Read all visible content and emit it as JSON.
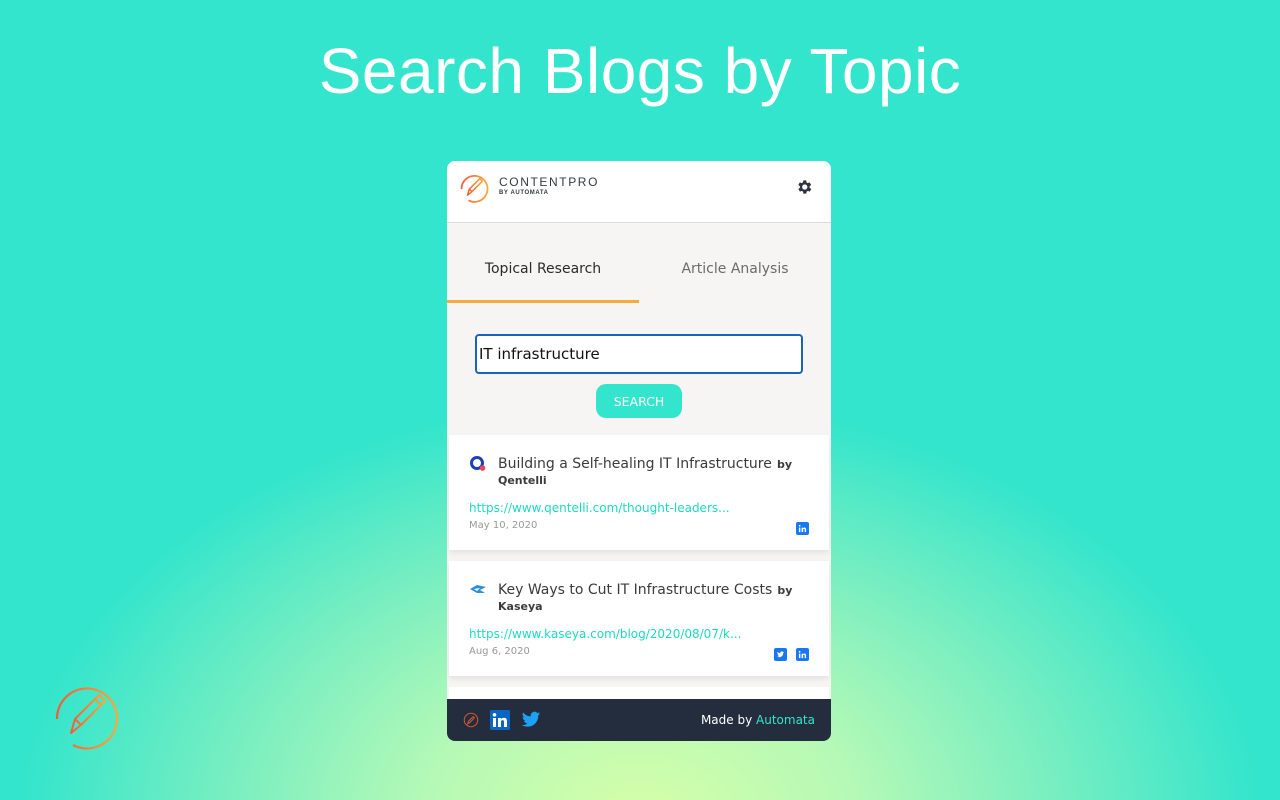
{
  "headline": "Search Blogs by Topic",
  "brand": {
    "name": "CONTENTPRO",
    "subtitle": "BY AUTOMATA",
    "logo_icon": "pencil-circle-icon",
    "gradient": [
      "#f25b3a",
      "#f9a93a"
    ]
  },
  "header": {
    "settings_icon": "gear-icon"
  },
  "tabs": [
    {
      "label": "Topical Research",
      "active": true
    },
    {
      "label": "Article Analysis",
      "active": false
    }
  ],
  "search": {
    "value": "IT infrastructure",
    "placeholder": "",
    "button_label": "SEARCH"
  },
  "results": [
    {
      "title": "Building a Self-healing IT Infrastructure",
      "by": "by",
      "author": "Qentelli",
      "url": "https://www.qentelli.com/thought-leaders...",
      "date": "May 10, 2020",
      "source_icon": "qentelli-logo-icon",
      "share": [
        "linkedin"
      ]
    },
    {
      "title": "Key Ways to Cut IT Infrastructure Costs",
      "by": "by",
      "author": "Kaseya",
      "url": "https://www.kaseya.com/blog/2020/08/07/k...",
      "date": "Aug 6, 2020",
      "source_icon": "kaseya-logo-icon",
      "share": [
        "twitter",
        "linkedin"
      ]
    }
  ],
  "footer": {
    "icons": [
      "contentpro-icon",
      "linkedin-icon",
      "twitter-icon"
    ],
    "made_by": "Made by",
    "company": "Automata"
  },
  "colors": {
    "accent": "#33e5cc",
    "tab_underline": "#f9a93a",
    "input_border": "#1565c0",
    "link": "#1ed9c1",
    "footer_bg": "#232d3e",
    "social_blue": "#1877f2"
  }
}
